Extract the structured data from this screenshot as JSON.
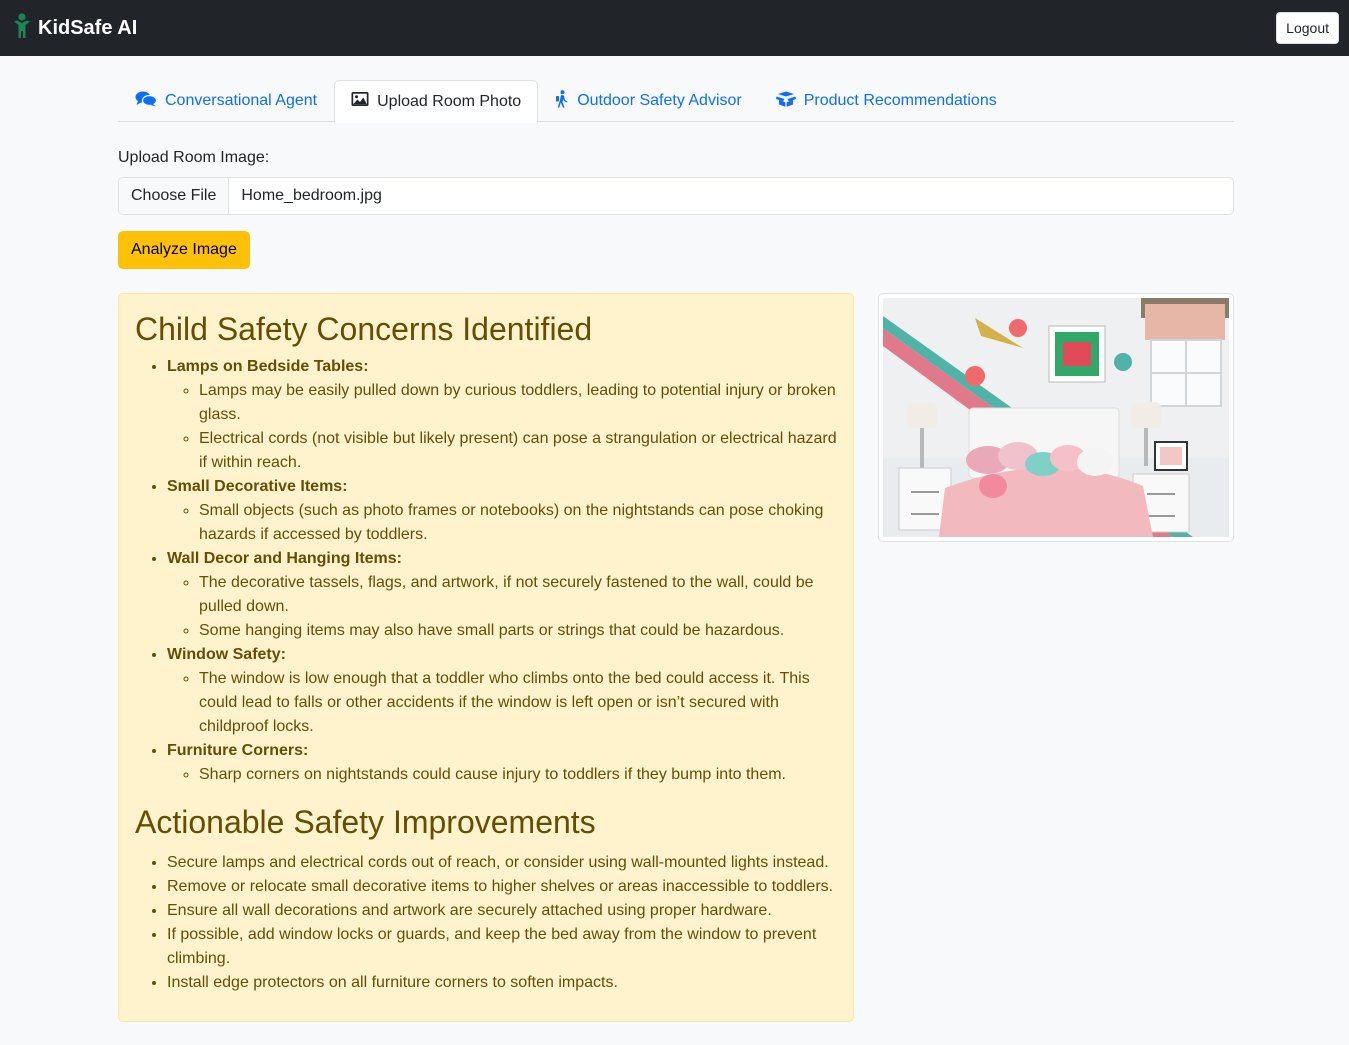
{
  "navbar": {
    "brand": "KidSafe AI",
    "logout_label": "Logout"
  },
  "tabs": [
    {
      "label": "Conversational Agent",
      "icon": "comments-icon",
      "active": false
    },
    {
      "label": "Upload Room Photo",
      "icon": "image-icon",
      "active": true
    },
    {
      "label": "Outdoor Safety Advisor",
      "icon": "hiking-icon",
      "active": false
    },
    {
      "label": "Product Recommendations",
      "icon": "box-icon",
      "active": false
    }
  ],
  "upload": {
    "label": "Upload Room Image:",
    "choose_file": "Choose File",
    "file_name": "Home_bedroom.jpg",
    "analyze_label": "Analyze Image"
  },
  "report": {
    "concerns_title": "Child Safety Concerns Identified",
    "concerns": [
      {
        "title": "Lamps on Bedside Tables:",
        "items": [
          "Lamps may be easily pulled down by curious toddlers, leading to potential injury or broken glass.",
          "Electrical cords (not visible but likely present) can pose a strangulation or electrical hazard if within reach."
        ]
      },
      {
        "title": "Small Decorative Items:",
        "items": [
          "Small objects (such as photo frames or notebooks) on the nightstands can pose choking hazards if accessed by toddlers."
        ]
      },
      {
        "title": "Wall Decor and Hanging Items:",
        "items": [
          "The decorative tassels, flags, and artwork, if not securely fastened to the wall, could be pulled down.",
          "Some hanging items may also have small parts or strings that could be hazardous."
        ]
      },
      {
        "title": "Window Safety:",
        "items": [
          "The window is low enough that a toddler who climbs onto the bed could access it. This could lead to falls or other accidents if the window is left open or isn’t secured with childproof locks."
        ]
      },
      {
        "title": "Furniture Corners:",
        "items": [
          "Sharp corners on nightstands could cause injury to toddlers if they bump into them."
        ]
      }
    ],
    "improvements_title": "Actionable Safety Improvements",
    "improvements": [
      "Secure lamps and electrical cords out of reach, or consider using wall-mounted lights instead.",
      "Remove or relocate small decorative items to higher shelves or areas inaccessible to toddlers.",
      "Ensure all wall decorations and artwork are securely attached using proper hardware.",
      "If possible, add window locks or guards, and keep the bed away from the window to prevent climbing.",
      "Install edge protectors on all furniture corners to soften impacts."
    ]
  },
  "colors": {
    "navbar": "#212529",
    "link": "#0d6efd",
    "warning": "#ffc107",
    "alert_bg": "#fff3cd",
    "alert_text": "#664d03",
    "brand_icon": "#198754"
  }
}
